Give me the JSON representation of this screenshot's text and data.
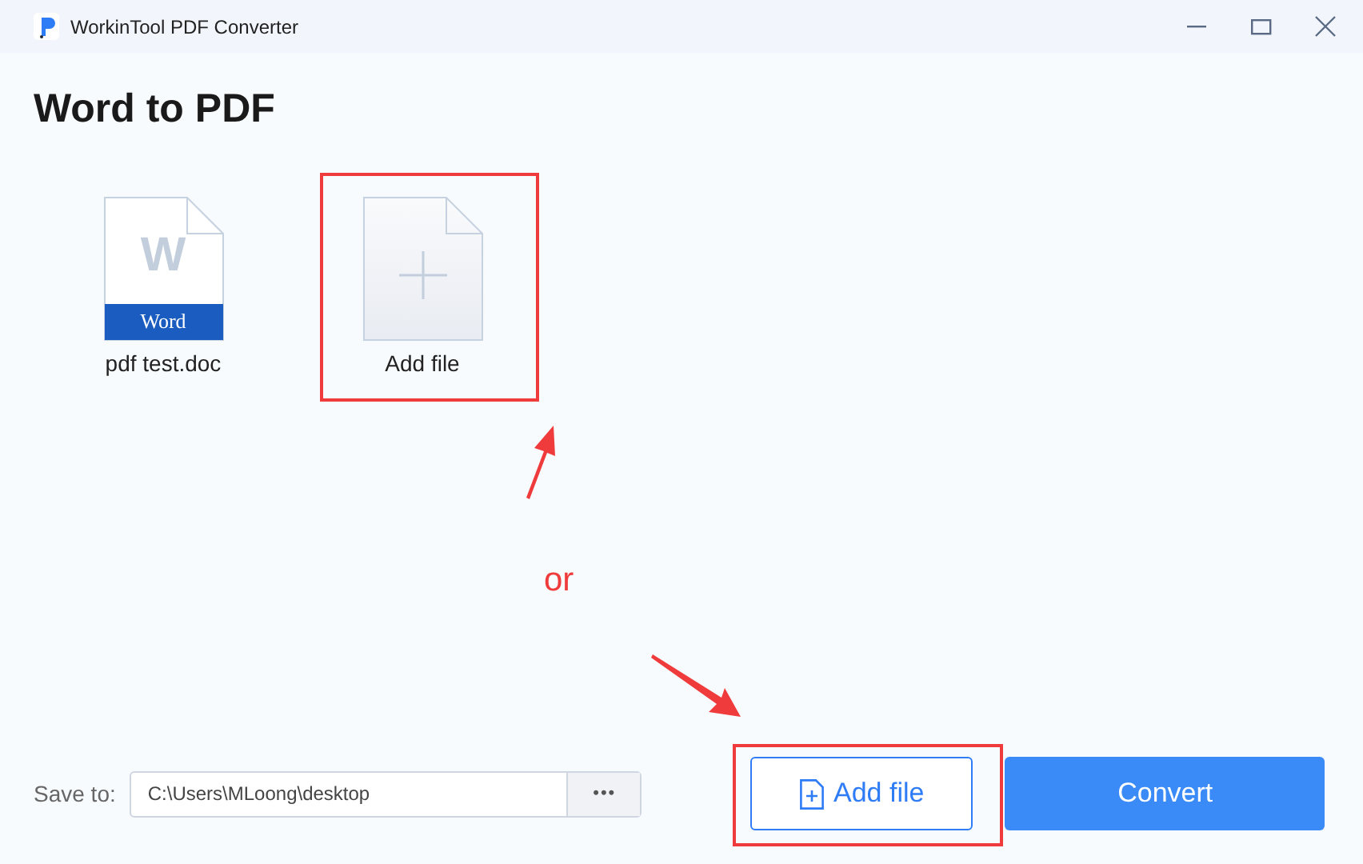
{
  "window": {
    "title": "WorkinTool PDF Converter"
  },
  "heading": "Word to PDF",
  "files": [
    {
      "kind": "doc",
      "letter": "W",
      "badge": "Word",
      "name": "pdf test.doc"
    },
    {
      "kind": "add",
      "name": "Add file"
    }
  ],
  "annotation": {
    "text": "or"
  },
  "footer": {
    "save_label": "Save to:",
    "path": "C:\\Users\\MLoong\\desktop",
    "browse": "•••",
    "add_button": "Add file",
    "convert_button": "Convert"
  }
}
